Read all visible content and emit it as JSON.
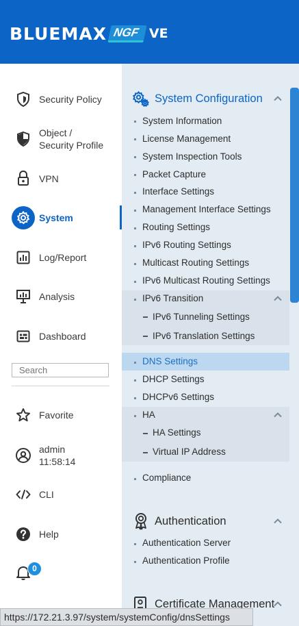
{
  "header": {
    "brand_main": "BLUEMAX",
    "brand_ngf": "NGF",
    "brand_ve": "VE"
  },
  "sidebar": {
    "items": [
      {
        "label": "Security Policy",
        "icon": "shield-icon"
      },
      {
        "label": "Object /\nSecurity Profile",
        "icon": "shield-half-icon"
      },
      {
        "label": "VPN",
        "icon": "lock-icon"
      },
      {
        "label": "System",
        "icon": "gear-icon",
        "active": true
      },
      {
        "label": "Log/Report",
        "icon": "bar-chart-icon"
      },
      {
        "label": "Analysis",
        "icon": "presentation-icon"
      },
      {
        "label": "Dashboard",
        "icon": "dashboard-icon"
      }
    ],
    "search_placeholder": "Search",
    "favorite_label": "Favorite",
    "user_name": "admin",
    "user_time": "11:58:14",
    "cli_label": "CLI",
    "help_label": "Help",
    "notification_count": "0",
    "accent_color": "#0b64c6"
  },
  "panel": {
    "system_config": {
      "title": "System Configuration",
      "items": [
        "System Information",
        "License Management",
        "System Inspection Tools",
        "Packet Capture",
        "Interface Settings",
        "Management Interface Settings",
        "Routing Settings",
        "IPv6 Routing Settings",
        "Multicast Routing Settings",
        "IPv6 Multicast Routing Settings"
      ],
      "ipv6_transition": {
        "label": "IPv6 Transition",
        "subitems": [
          "IPv6 Tunneling Settings",
          "IPv6 Translation Settings"
        ]
      },
      "items2": [
        "DNS Settings",
        "DHCP Settings",
        "DHCPv6 Settings"
      ],
      "selected": "DNS Settings",
      "ha": {
        "label": "HA",
        "subitems": [
          "HA Settings",
          "Virtual IP Address"
        ]
      },
      "compliance": "Compliance"
    },
    "authentication": {
      "title": "Authentication",
      "items": [
        "Authentication Server",
        "Authentication Profile"
      ]
    },
    "certificate": {
      "title": "Certificate Management"
    }
  },
  "statusbar": {
    "url": "https://172.21.3.97/system/systemConfig/dnsSettings"
  }
}
